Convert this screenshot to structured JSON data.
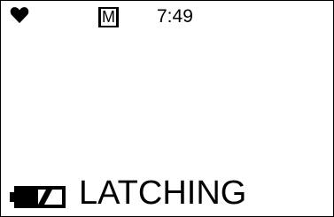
{
  "status_bar": {
    "heart_icon": "heart-icon",
    "mode_label": "M",
    "time": "7:49"
  },
  "footer": {
    "battery_icon": "battery-icon",
    "battery_level": 0.5,
    "status_text": "LATCHING"
  },
  "colors": {
    "foreground": "#000000",
    "background": "#ffffff"
  }
}
